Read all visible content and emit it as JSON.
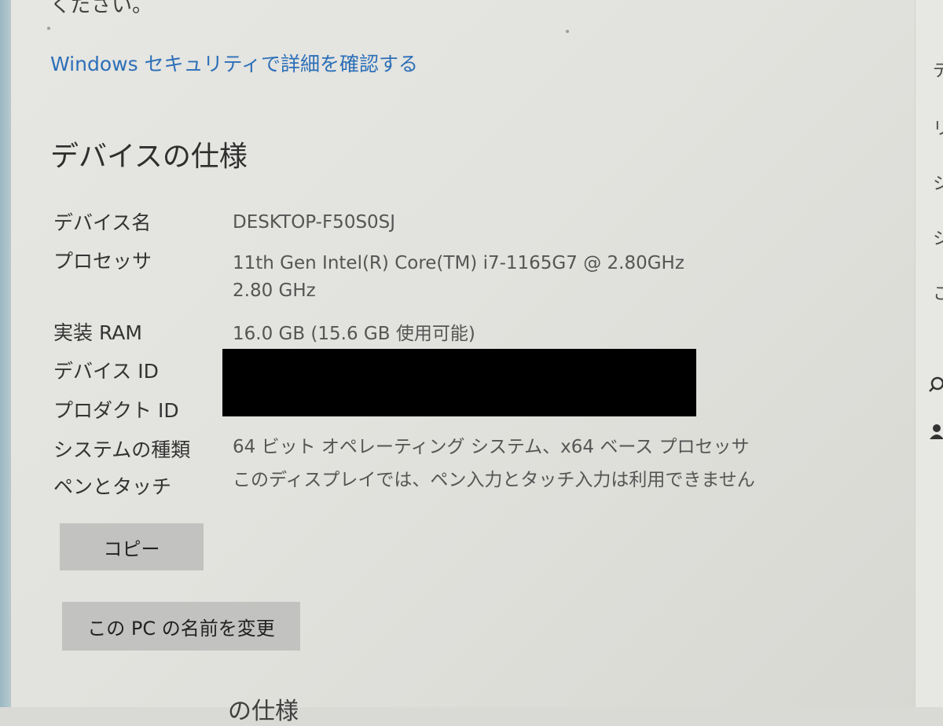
{
  "top_text": "ください。",
  "security_link": "Windows セキュリティで詳細を確認する",
  "section_title": "デバイスの仕様",
  "specs": [
    {
      "label": "デバイス名",
      "value": "DESKTOP-F50S0SJ"
    },
    {
      "label": "プロセッサ",
      "value": "11th Gen Intel(R) Core(TM) i7-1165G7 @ 2.80GHz",
      "value2": "2.80 GHz"
    },
    {
      "label": "実装 RAM",
      "value": "16.0 GB (15.6 GB 使用可能)"
    },
    {
      "label": "デバイス ID",
      "value": ""
    },
    {
      "label": "プロダクト ID",
      "value": ""
    },
    {
      "label": "システムの種類",
      "value": "64 ビット オペレーティング システム、x64 ベース プロセッサ"
    },
    {
      "label": "ペンとタッチ",
      "value": "このディスプレイでは、ペン入力とタッチ入力は利用できません"
    }
  ],
  "buttons": {
    "copy": "コピー",
    "rename": "この PC の名前を変更"
  },
  "bottom_text": "の仕様",
  "right_edge_glyphs": [
    "デ",
    "リ",
    "シ",
    "シ",
    "こ"
  ],
  "right_edge_icons": [
    "search-icon",
    "person-icon"
  ],
  "colors": {
    "link": "#2c6fb8",
    "button": "#c2c2c0",
    "redaction": "#000000"
  }
}
